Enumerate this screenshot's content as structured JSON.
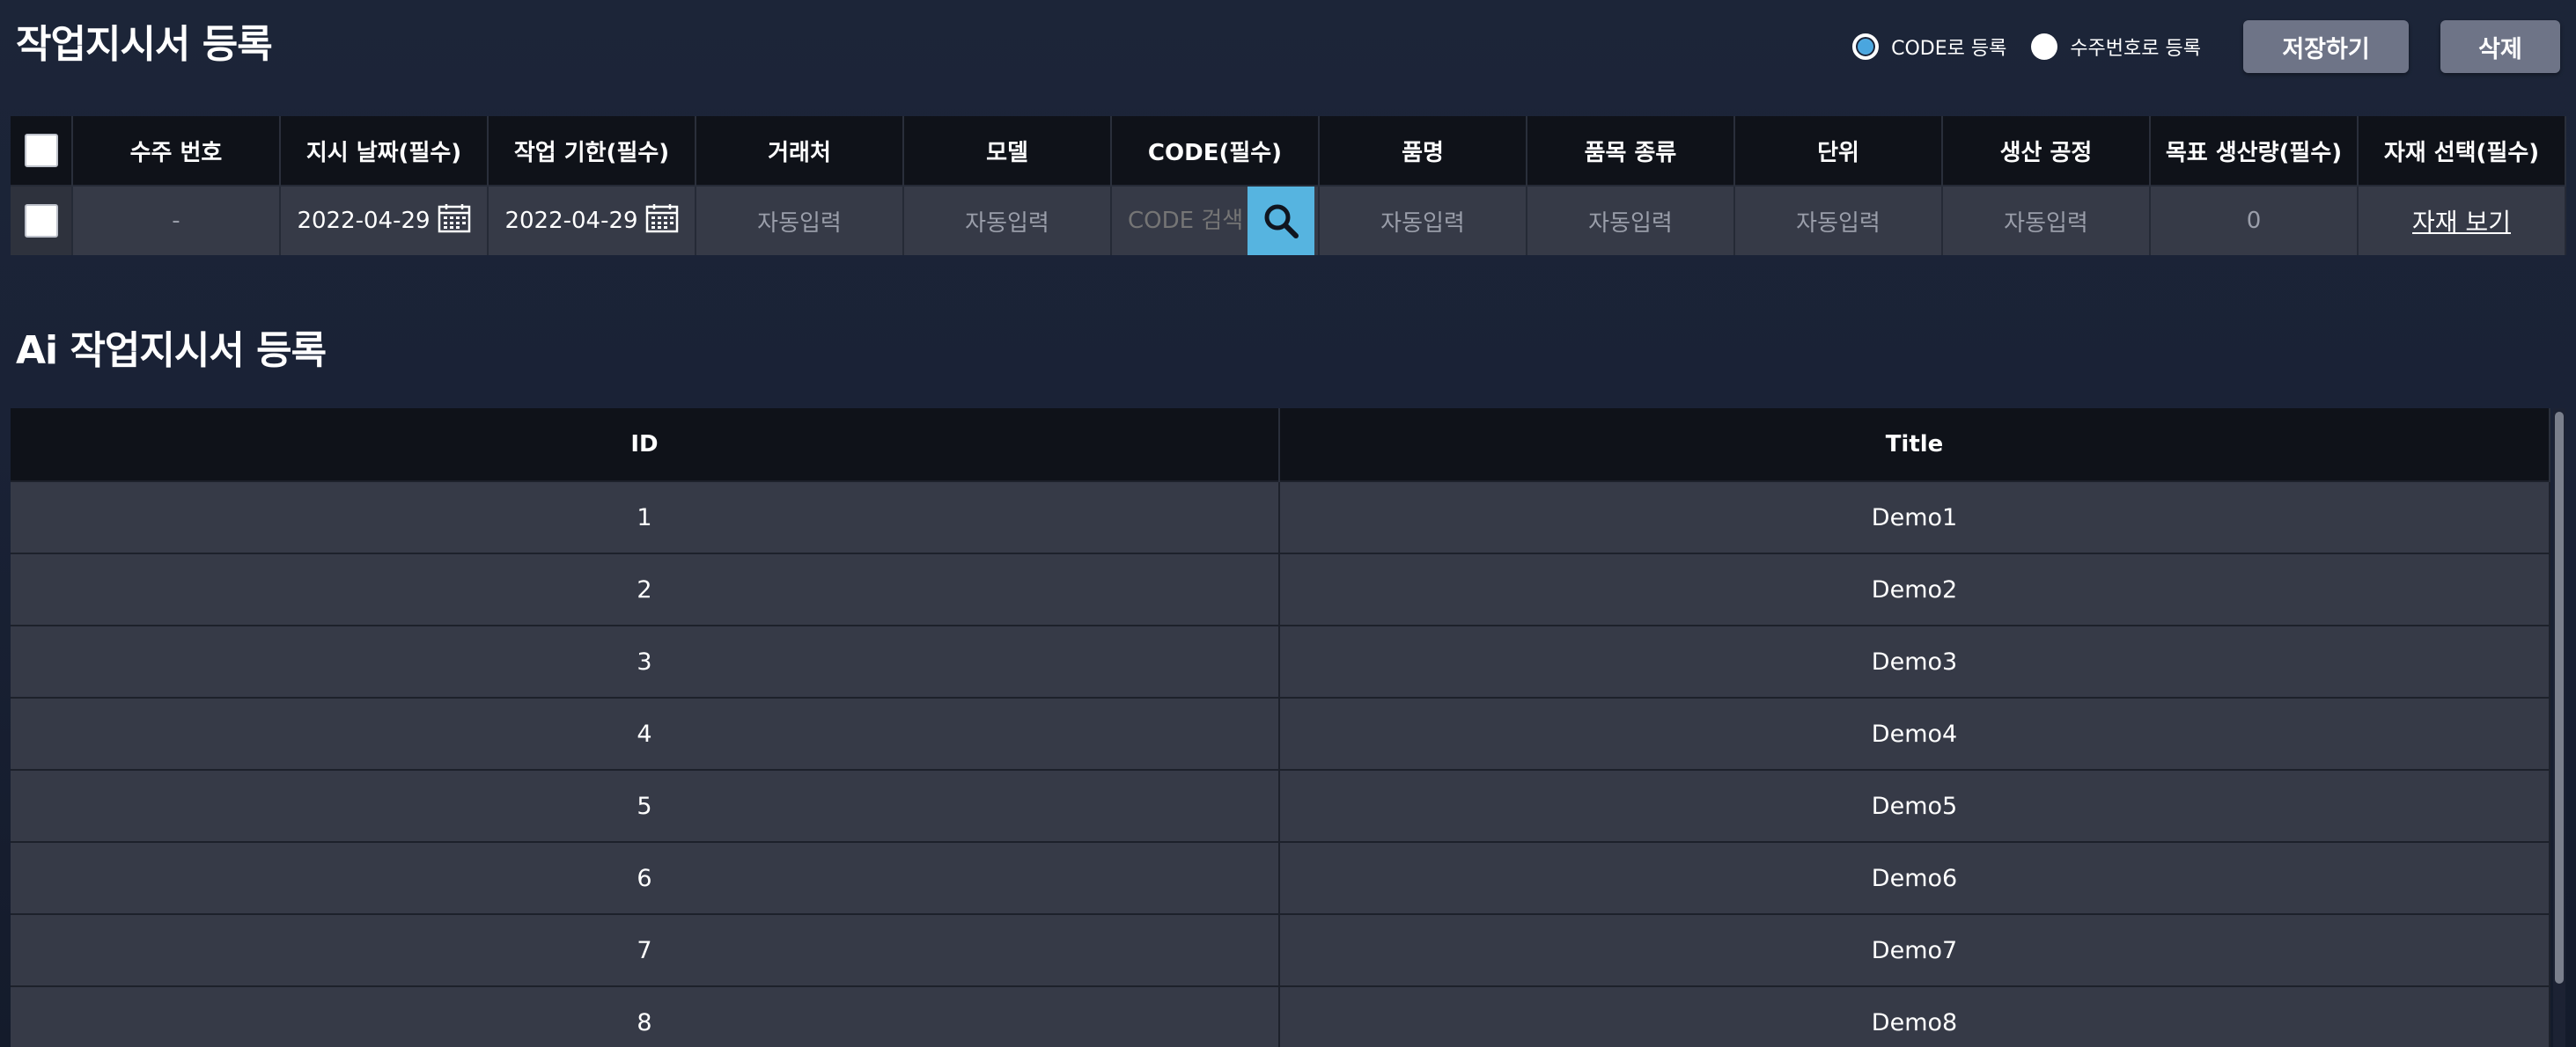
{
  "page": {
    "title": "작업지시서 등록",
    "ai_title": "Ai 작업지시서 등록"
  },
  "register_mode": {
    "options": [
      {
        "label": "CODE로 등록",
        "checked": true
      },
      {
        "label": "수주번호로 등록",
        "checked": false
      }
    ]
  },
  "toolbar": {
    "save_label": "저장하기",
    "delete_label": "삭제"
  },
  "form_table": {
    "headers": [
      "수주 번호",
      "지시 날짜(필수)",
      "작업 기한(필수)",
      "거래처",
      "모델",
      "CODE(필수)",
      "품명",
      "품목 종류",
      "단위",
      "생산 공정",
      "목표 생산량(필수)",
      "자재 선택(필수)"
    ],
    "row": {
      "order_no": "-",
      "instruction_date": "2022-04-29",
      "deadline": "2022-04-29",
      "client": "자동입력",
      "model": "자동입력",
      "code_placeholder": "CODE 검색",
      "product_name": "자동입력",
      "item_type": "자동입력",
      "unit": "자동입력",
      "process": "자동입력",
      "target_qty": "0",
      "material_link": "자재 보기"
    }
  },
  "ai_table": {
    "headers": [
      "ID",
      "Title"
    ],
    "rows": [
      {
        "id": "1",
        "title": "Demo1"
      },
      {
        "id": "2",
        "title": "Demo2"
      },
      {
        "id": "3",
        "title": "Demo3"
      },
      {
        "id": "4",
        "title": "Demo4"
      },
      {
        "id": "5",
        "title": "Demo5"
      },
      {
        "id": "6",
        "title": "Demo6"
      },
      {
        "id": "7",
        "title": "Demo7"
      },
      {
        "id": "8",
        "title": "Demo8"
      }
    ]
  },
  "colors": {
    "accent": "#56b4e0",
    "button": "#6e7487",
    "header_bg": "#0f1219",
    "cell_bg": "#363a47"
  },
  "icons": {
    "calendar": "calendar-icon",
    "search": "search-icon"
  }
}
